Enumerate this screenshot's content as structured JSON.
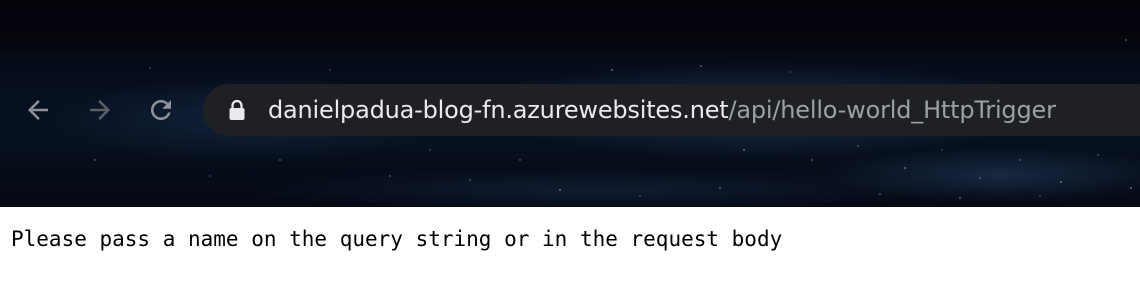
{
  "browser": {
    "nav": {
      "back_icon": "arrow-left-icon",
      "forward_icon": "arrow-right-icon",
      "reload_icon": "reload-icon"
    },
    "omnibox": {
      "lock_icon": "lock-icon",
      "url_host": "danielpadua-blog-fn.azurewebsites.net",
      "url_path": "/api/hello-world_HttpTrigger"
    },
    "colors": {
      "omnibox_bg": "#1e2023",
      "host_text": "#e8eaed",
      "path_text": "#9aa0a6",
      "icon_color": "#8e9298"
    }
  },
  "page": {
    "message": "Please pass a name on the query string or in the request body"
  }
}
